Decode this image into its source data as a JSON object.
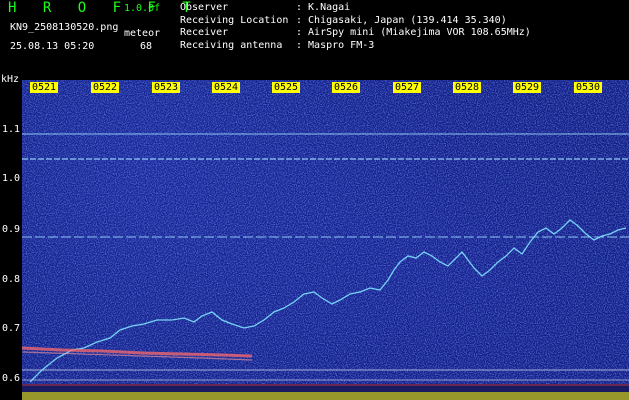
{
  "header": {
    "brand": "H R O F F T",
    "version": "1.0.0f",
    "filename": "KN9_2508130520.png",
    "datetime": "25.08.13 05:20",
    "meteor_label": "meteor",
    "meteor_count": "68"
  },
  "info": [
    {
      "key": "Observer",
      "value": ": K.Nagai"
    },
    {
      "key": "Receiving Location",
      "value": ": Chigasaki, Japan (139.414 35.340)"
    },
    {
      "key": "Receiver",
      "value": ": AirSpy mini (Miakejima VOR 108.65MHz)"
    },
    {
      "key": "Receiving antenna",
      "value": ": Maspro FM-3"
    }
  ],
  "axis": {
    "unit": "kHz",
    "y_labels": [
      "1.1",
      "1.0",
      "0.9",
      "0.8",
      "0.7",
      "0.6"
    ],
    "time_ticks": [
      "0521",
      "0522",
      "0523",
      "0524",
      "0525",
      "0526",
      "0527",
      "0528",
      "0529",
      "0530"
    ]
  },
  "colors": {
    "background": "#000000",
    "plot_bg": "#101a82",
    "brand_green": "#1aff1a",
    "tick_bg": "#ffff00",
    "trace_cyan": "#7fe3ff",
    "carrier_red": "#ff6a6a",
    "baseline_yellow": "#ffff00"
  }
}
